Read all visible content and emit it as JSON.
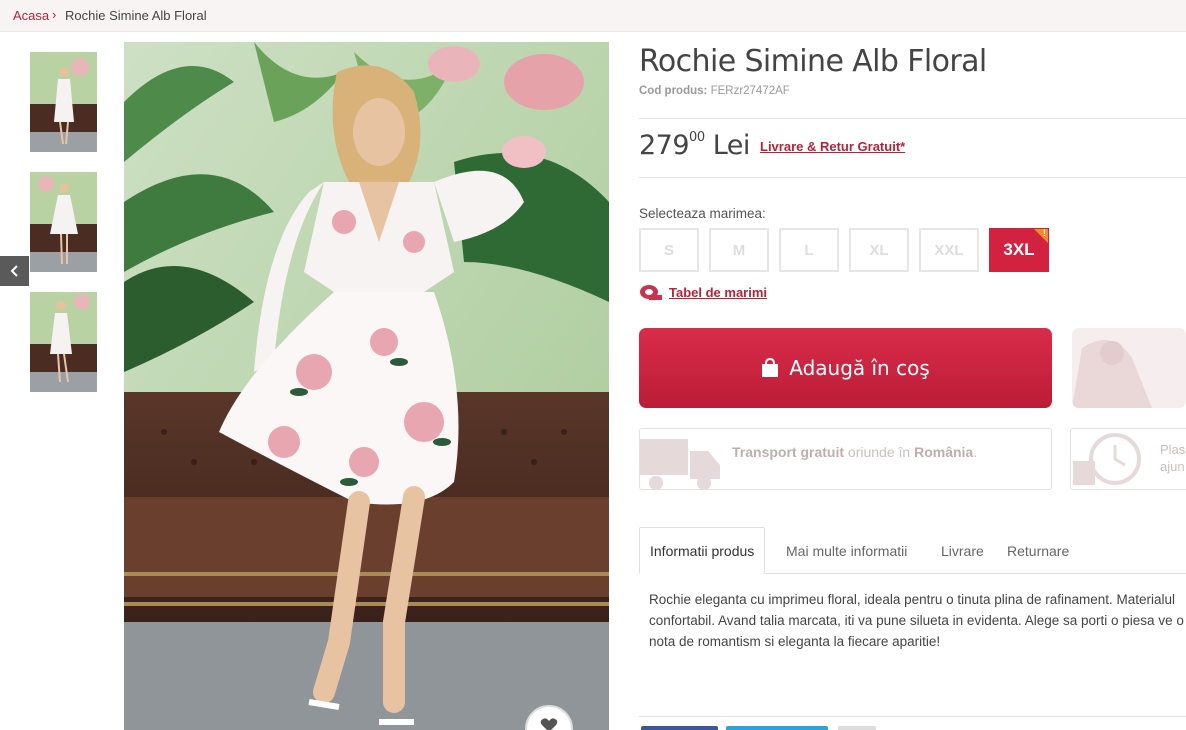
{
  "breadcrumb": {
    "home": "Acasa",
    "separator": "›",
    "current": "Rochie Simine Alb Floral"
  },
  "product": {
    "title": "Rochie Simine Alb Floral",
    "code_label": "Cod produs:",
    "code_value": "FERzr27472AF",
    "price_main": "279",
    "price_cents": "00",
    "currency": "Lei",
    "shipping_link": "Livrare & Retur Gratuit*"
  },
  "sizes": {
    "label": "Selecteaza marimea:",
    "options": [
      "S",
      "M",
      "L",
      "XL",
      "XXL",
      "3XL"
    ],
    "selected": "3XL",
    "chart_link": "Tabel de marimi"
  },
  "cart": {
    "add_label": "Adaugă în coş"
  },
  "info": {
    "transport_bold": "Transport gratuit",
    "transport_mid": "oriunde în",
    "transport_country": "România",
    "transport_end": ".",
    "second_line1": "Plas",
    "second_line2": "ajun"
  },
  "tabs": [
    "Informatii produs",
    "Mai multe informatii",
    "Livrare",
    "Returnare"
  ],
  "description": "Rochie eleganta cu imprimeu floral, ideala pentru o tinuta plina de rafinament. Materialul confortabil. Avand talia marcata, iti va pune silueta in evidenta. Alege sa porti o piesa ve o nota de romantism si eleganta la fiecare aparitie!",
  "colors": {
    "accent": "#b3243b",
    "button": "#d32240",
    "flag": "#f08a2a"
  },
  "icons": {
    "gallery_prev": "chevron-left-icon",
    "wishlist": "heart-icon",
    "cart": "shopping-bag-icon",
    "size_chart": "measuring-tape-icon",
    "transport": "delivery-truck-icon",
    "time": "clock-icon"
  }
}
